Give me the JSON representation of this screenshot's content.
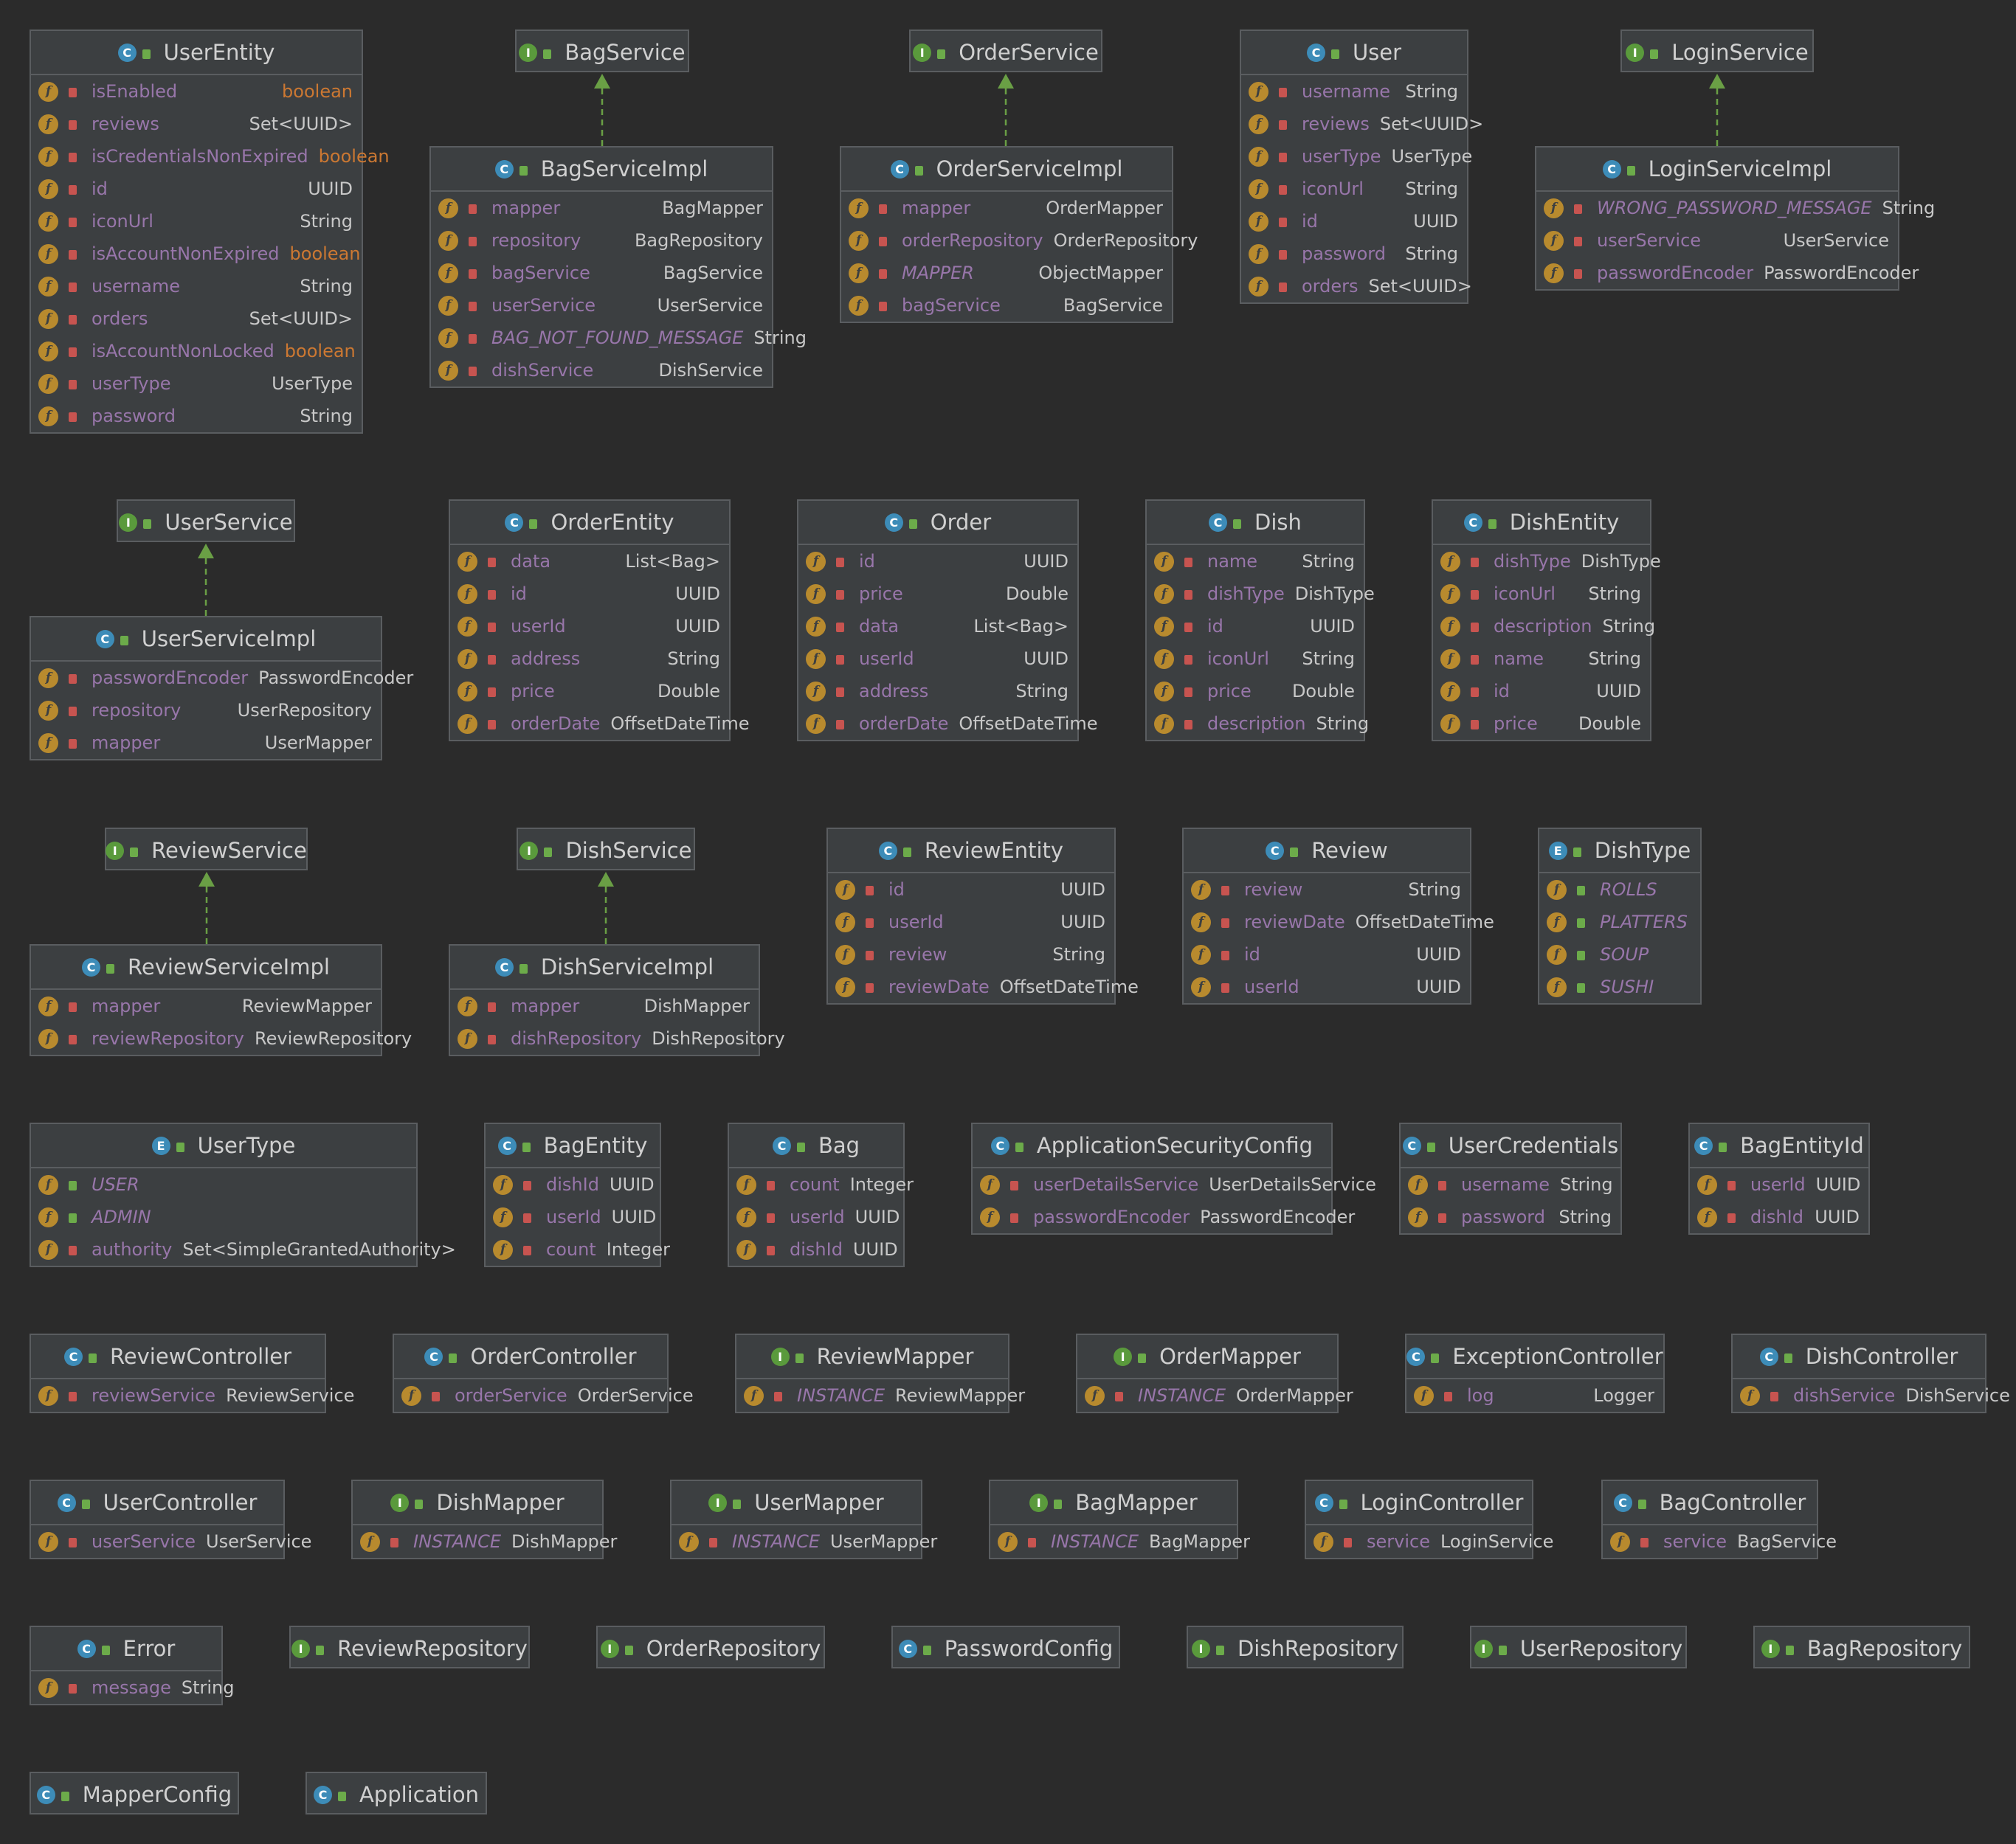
{
  "colors": {
    "background": "#2b2b2b",
    "box": "#3c3f41",
    "border": "#5a5d60",
    "field_name": "#9876aa",
    "keyword_type": "#cc7832",
    "class_icon": "#3d8cb8",
    "interface_icon": "#5a9a3c",
    "field_icon": "#b88a2e",
    "private_lock": "#c75450",
    "inheritance_arrow": "#6a9f45"
  },
  "icons": {
    "C": "class-icon",
    "I": "interface-icon",
    "E": "enum-icon",
    "f": "field-icon"
  },
  "boxes": [
    {
      "id": "UserEntity",
      "kind": "C",
      "title": "UserEntity",
      "fields": [
        [
          "isEnabled",
          "boolean"
        ],
        [
          "reviews",
          "Set<UUID>"
        ],
        [
          "isCredentialsNonExpired",
          "boolean"
        ],
        [
          "id",
          "UUID"
        ],
        [
          "iconUrl",
          "String"
        ],
        [
          "isAccountNonExpired",
          "boolean"
        ],
        [
          "username",
          "String"
        ],
        [
          "orders",
          "Set<UUID>"
        ],
        [
          "isAccountNonLocked",
          "boolean"
        ],
        [
          "userType",
          "UserType"
        ],
        [
          "password",
          "String"
        ]
      ]
    },
    {
      "id": "BagService",
      "kind": "I",
      "title": "BagService",
      "fields": []
    },
    {
      "id": "BagServiceImpl",
      "kind": "C",
      "title": "BagServiceImpl",
      "fields": [
        [
          "mapper",
          "BagMapper"
        ],
        [
          "repository",
          "BagRepository"
        ],
        [
          "bagService",
          "BagService"
        ],
        [
          "userService",
          "UserService"
        ],
        [
          "BAG_NOT_FOUND_MESSAGE",
          "String"
        ],
        [
          "dishService",
          "DishService"
        ]
      ]
    },
    {
      "id": "OrderService",
      "kind": "I",
      "title": "OrderService",
      "fields": []
    },
    {
      "id": "OrderServiceImpl",
      "kind": "C",
      "title": "OrderServiceImpl",
      "fields": [
        [
          "mapper",
          "OrderMapper"
        ],
        [
          "orderRepository",
          "OrderRepository"
        ],
        [
          "MAPPER",
          "ObjectMapper"
        ],
        [
          "bagService",
          "BagService"
        ]
      ]
    },
    {
      "id": "User",
      "kind": "C",
      "title": "User",
      "fields": [
        [
          "username",
          "String"
        ],
        [
          "reviews",
          "Set<UUID>"
        ],
        [
          "userType",
          "UserType"
        ],
        [
          "iconUrl",
          "String"
        ],
        [
          "id",
          "UUID"
        ],
        [
          "password",
          "String"
        ],
        [
          "orders",
          "Set<UUID>"
        ]
      ]
    },
    {
      "id": "LoginService",
      "kind": "I",
      "title": "LoginService",
      "fields": []
    },
    {
      "id": "LoginServiceImpl",
      "kind": "C",
      "title": "LoginServiceImpl",
      "fields": [
        [
          "WRONG_PASSWORD_MESSAGE",
          "String"
        ],
        [
          "userService",
          "UserService"
        ],
        [
          "passwordEncoder",
          "PasswordEncoder"
        ]
      ]
    },
    {
      "id": "UserService",
      "kind": "I",
      "title": "UserService",
      "fields": []
    },
    {
      "id": "UserServiceImpl",
      "kind": "C",
      "title": "UserServiceImpl",
      "fields": [
        [
          "passwordEncoder",
          "PasswordEncoder"
        ],
        [
          "repository",
          "UserRepository"
        ],
        [
          "mapper",
          "UserMapper"
        ]
      ]
    },
    {
      "id": "OrderEntity",
      "kind": "C",
      "title": "OrderEntity",
      "fields": [
        [
          "data",
          "List<Bag>"
        ],
        [
          "id",
          "UUID"
        ],
        [
          "userId",
          "UUID"
        ],
        [
          "address",
          "String"
        ],
        [
          "price",
          "Double"
        ],
        [
          "orderDate",
          "OffsetDateTime"
        ]
      ]
    },
    {
      "id": "Order",
      "kind": "C",
      "title": "Order",
      "fields": [
        [
          "id",
          "UUID"
        ],
        [
          "price",
          "Double"
        ],
        [
          "data",
          "List<Bag>"
        ],
        [
          "userId",
          "UUID"
        ],
        [
          "address",
          "String"
        ],
        [
          "orderDate",
          "OffsetDateTime"
        ]
      ]
    },
    {
      "id": "Dish",
      "kind": "C",
      "title": "Dish",
      "fields": [
        [
          "name",
          "String"
        ],
        [
          "dishType",
          "DishType"
        ],
        [
          "id",
          "UUID"
        ],
        [
          "iconUrl",
          "String"
        ],
        [
          "price",
          "Double"
        ],
        [
          "description",
          "String"
        ]
      ]
    },
    {
      "id": "DishEntity",
      "kind": "C",
      "title": "DishEntity",
      "fields": [
        [
          "dishType",
          "DishType"
        ],
        [
          "iconUrl",
          "String"
        ],
        [
          "description",
          "String"
        ],
        [
          "name",
          "String"
        ],
        [
          "id",
          "UUID"
        ],
        [
          "price",
          "Double"
        ]
      ]
    },
    {
      "id": "ReviewService",
      "kind": "I",
      "title": "ReviewService",
      "fields": []
    },
    {
      "id": "DishService",
      "kind": "I",
      "title": "DishService",
      "fields": []
    },
    {
      "id": "ReviewEntity",
      "kind": "C",
      "title": "ReviewEntity",
      "fields": [
        [
          "id",
          "UUID"
        ],
        [
          "userId",
          "UUID"
        ],
        [
          "review",
          "String"
        ],
        [
          "reviewDate",
          "OffsetDateTime"
        ]
      ]
    },
    {
      "id": "Review",
      "kind": "C",
      "title": "Review",
      "fields": [
        [
          "review",
          "String"
        ],
        [
          "reviewDate",
          "OffsetDateTime"
        ],
        [
          "id",
          "UUID"
        ],
        [
          "userId",
          "UUID"
        ]
      ]
    },
    {
      "id": "DishType",
      "kind": "E",
      "title": "DishType",
      "fields": [
        [
          "ROLLS",
          ""
        ],
        [
          "PLATTERS",
          ""
        ],
        [
          "SOUP",
          ""
        ],
        [
          "SUSHI",
          ""
        ]
      ]
    },
    {
      "id": "ReviewServiceImpl",
      "kind": "C",
      "title": "ReviewServiceImpl",
      "fields": [
        [
          "mapper",
          "ReviewMapper"
        ],
        [
          "reviewRepository",
          "ReviewRepository"
        ]
      ]
    },
    {
      "id": "DishServiceImpl",
      "kind": "C",
      "title": "DishServiceImpl",
      "fields": [
        [
          "mapper",
          "DishMapper"
        ],
        [
          "dishRepository",
          "DishRepository"
        ]
      ]
    },
    {
      "id": "UserType",
      "kind": "E",
      "title": "UserType",
      "fields": [
        [
          "USER",
          ""
        ],
        [
          "ADMIN",
          ""
        ],
        [
          "authority",
          "Set<SimpleGrantedAuthority>"
        ]
      ]
    },
    {
      "id": "BagEntity",
      "kind": "C",
      "title": "BagEntity",
      "fields": [
        [
          "dishId",
          "UUID"
        ],
        [
          "userId",
          "UUID"
        ],
        [
          "count",
          "Integer"
        ]
      ]
    },
    {
      "id": "Bag",
      "kind": "C",
      "title": "Bag",
      "fields": [
        [
          "count",
          "Integer"
        ],
        [
          "userId",
          "UUID"
        ],
        [
          "dishId",
          "UUID"
        ]
      ]
    },
    {
      "id": "ApplicationSecurityConfig",
      "kind": "C",
      "title": "ApplicationSecurityConfig",
      "fields": [
        [
          "userDetailsService",
          "UserDetailsService"
        ],
        [
          "passwordEncoder",
          "PasswordEncoder"
        ]
      ]
    },
    {
      "id": "UserCredentials",
      "kind": "C",
      "title": "UserCredentials",
      "fields": [
        [
          "username",
          "String"
        ],
        [
          "password",
          "String"
        ]
      ]
    },
    {
      "id": "BagEntityId",
      "kind": "C",
      "title": "BagEntityId",
      "fields": [
        [
          "userId",
          "UUID"
        ],
        [
          "dishId",
          "UUID"
        ]
      ]
    },
    {
      "id": "ReviewController",
      "kind": "C",
      "title": "ReviewController",
      "fields": [
        [
          "reviewService",
          "ReviewService"
        ]
      ]
    },
    {
      "id": "OrderController",
      "kind": "C",
      "title": "OrderController",
      "fields": [
        [
          "orderService",
          "OrderService"
        ]
      ]
    },
    {
      "id": "ReviewMapper",
      "kind": "I",
      "title": "ReviewMapper",
      "fields": [
        [
          "INSTANCE",
          "ReviewMapper"
        ]
      ]
    },
    {
      "id": "OrderMapper",
      "kind": "I",
      "title": "OrderMapper",
      "fields": [
        [
          "INSTANCE",
          "OrderMapper"
        ]
      ]
    },
    {
      "id": "ExceptionController",
      "kind": "C",
      "title": "ExceptionController",
      "fields": [
        [
          "log",
          "Logger"
        ]
      ]
    },
    {
      "id": "DishController",
      "kind": "C",
      "title": "DishController",
      "fields": [
        [
          "dishService",
          "DishService"
        ]
      ]
    },
    {
      "id": "UserController",
      "kind": "C",
      "title": "UserController",
      "fields": [
        [
          "userService",
          "UserService"
        ]
      ]
    },
    {
      "id": "DishMapper",
      "kind": "I",
      "title": "DishMapper",
      "fields": [
        [
          "INSTANCE",
          "DishMapper"
        ]
      ]
    },
    {
      "id": "UserMapper",
      "kind": "I",
      "title": "UserMapper",
      "fields": [
        [
          "INSTANCE",
          "UserMapper"
        ]
      ]
    },
    {
      "id": "BagMapper",
      "kind": "I",
      "title": "BagMapper",
      "fields": [
        [
          "INSTANCE",
          "BagMapper"
        ]
      ]
    },
    {
      "id": "LoginController",
      "kind": "C",
      "title": "LoginController",
      "fields": [
        [
          "service",
          "LoginService"
        ]
      ]
    },
    {
      "id": "BagController",
      "kind": "C",
      "title": "BagController",
      "fields": [
        [
          "service",
          "BagService"
        ]
      ]
    },
    {
      "id": "Error",
      "kind": "C",
      "title": "Error",
      "fields": [
        [
          "message",
          "String"
        ]
      ]
    },
    {
      "id": "ReviewRepository",
      "kind": "I",
      "title": "ReviewRepository",
      "fields": []
    },
    {
      "id": "OrderRepository",
      "kind": "I",
      "title": "OrderRepository",
      "fields": []
    },
    {
      "id": "PasswordConfig",
      "kind": "C",
      "title": "PasswordConfig",
      "fields": []
    },
    {
      "id": "DishRepository",
      "kind": "I",
      "title": "DishRepository",
      "fields": []
    },
    {
      "id": "UserRepository",
      "kind": "I",
      "title": "UserRepository",
      "fields": []
    },
    {
      "id": "BagRepository",
      "kind": "I",
      "title": "BagRepository",
      "fields": []
    },
    {
      "id": "MapperConfig",
      "kind": "C",
      "title": "MapperConfig",
      "fields": []
    },
    {
      "id": "Application",
      "kind": "C",
      "title": "Application",
      "fields": []
    }
  ],
  "relations": [
    {
      "from": "BagServiceImpl",
      "to": "BagService"
    },
    {
      "from": "OrderServiceImpl",
      "to": "OrderService"
    },
    {
      "from": "LoginServiceImpl",
      "to": "LoginService"
    },
    {
      "from": "UserServiceImpl",
      "to": "UserService"
    },
    {
      "from": "ReviewServiceImpl",
      "to": "ReviewService"
    },
    {
      "from": "DishServiceImpl",
      "to": "DishService"
    }
  ]
}
